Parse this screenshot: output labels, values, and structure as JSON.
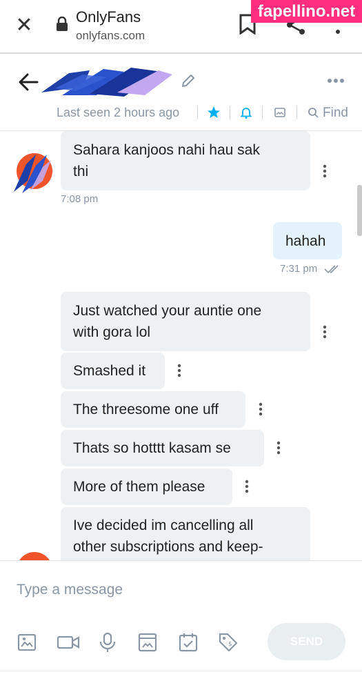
{
  "browser": {
    "title": "OnlyFans",
    "domain": "onlyfans.com",
    "watermark": "fapellino.net"
  },
  "header": {
    "contact_name": "A",
    "last_seen": "Last seen 2 hours ago",
    "find_label": "Find"
  },
  "messages": [
    {
      "direction": "in",
      "lines": [
        "Sahara kanjoos nahi hau sak",
        "thi"
      ],
      "time": "7:08 pm"
    },
    {
      "direction": "out",
      "lines": [
        "hahah"
      ],
      "time": "7:31 pm"
    },
    {
      "direction": "in",
      "lines": [
        "Just watched your auntie one",
        "with gora lol"
      ]
    },
    {
      "direction": "in",
      "lines": [
        "Smashed it"
      ]
    },
    {
      "direction": "in",
      "lines": [
        "The threesome one uff"
      ]
    },
    {
      "direction": "in",
      "lines": [
        "Thats so hotttt kasam se"
      ]
    },
    {
      "direction": "in",
      "lines": [
        "More of them please"
      ]
    },
    {
      "direction": "in",
      "lines": [
        "Ive decided im cancelling all",
        "other subscriptions and keep-"
      ]
    }
  ],
  "composer": {
    "placeholder": "Type a message",
    "send_label": "SEND"
  },
  "colors": {
    "accent": "#00aff0",
    "incoming_bubble": "#eef1f3",
    "outgoing_bubble": "#e4f3fb",
    "watermark": "#ff2d7e"
  }
}
